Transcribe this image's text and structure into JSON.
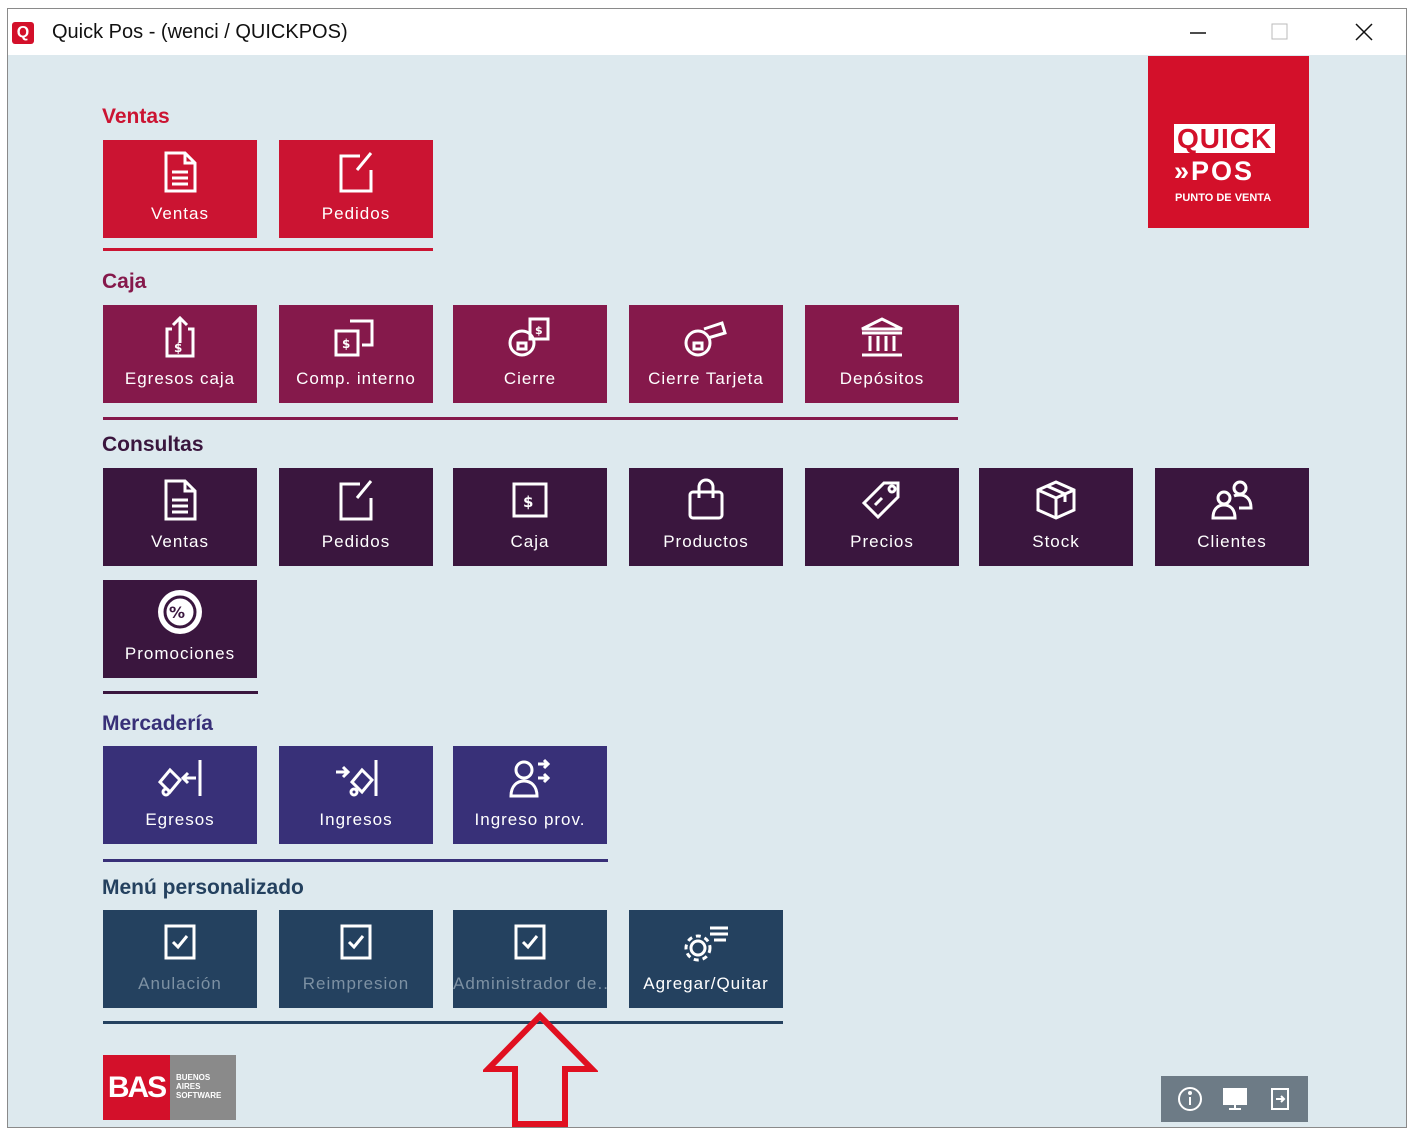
{
  "window": {
    "title": "Quick Pos - (wenci / QUICKPOS)",
    "app_icon": "Q",
    "controls": [
      "minimize-icon",
      "maximize-icon",
      "close-icon"
    ]
  },
  "logo": {
    "line1": "QUICK",
    "line2": "»POS",
    "line3": "PUNTO DE VENTA"
  },
  "sections": {
    "ventas": {
      "title": "Ventas",
      "color": "#cb1432",
      "tiles": [
        {
          "label": "Ventas",
          "icon": "document-icon"
        },
        {
          "label": "Pedidos",
          "icon": "edit-icon"
        }
      ]
    },
    "caja": {
      "title": "Caja",
      "color": "#85194b",
      "tiles": [
        {
          "label": "Egresos caja",
          "icon": "money-upload-icon"
        },
        {
          "label": "Comp. interno",
          "icon": "money-transfer-icon"
        },
        {
          "label": "Cierre",
          "icon": "cash-lock-icon"
        },
        {
          "label": "Cierre Tarjeta",
          "icon": "card-lock-icon"
        },
        {
          "label": "Depósitos",
          "icon": "bank-icon"
        }
      ]
    },
    "consultas": {
      "title": "Consultas",
      "color": "#3a163e",
      "tiles": [
        {
          "label": "Ventas",
          "icon": "document-icon"
        },
        {
          "label": "Pedidos",
          "icon": "edit-icon"
        },
        {
          "label": "Caja",
          "icon": "cash-icon"
        },
        {
          "label": "Productos",
          "icon": "shopping-bag-icon"
        },
        {
          "label": "Precios",
          "icon": "price-tag-icon"
        },
        {
          "label": "Stock",
          "icon": "box-icon"
        },
        {
          "label": "Clientes",
          "icon": "users-icon"
        },
        {
          "label": "Promociones",
          "icon": "percent-badge-icon"
        }
      ]
    },
    "mercaderia": {
      "title": "Mercadería",
      "color": "#383078",
      "tiles": [
        {
          "label": "Egresos",
          "icon": "dolly-out-icon"
        },
        {
          "label": "Ingresos",
          "icon": "dolly-in-icon"
        },
        {
          "label": "Ingreso prov.",
          "icon": "supplier-icon"
        }
      ]
    },
    "personalizado": {
      "title": "Menú personalizado",
      "color": "#24415f",
      "tiles": [
        {
          "label": "Anulación",
          "icon": "checkbox-icon",
          "enabled": false
        },
        {
          "label": "Reimpresion",
          "icon": "checkbox-icon",
          "enabled": false
        },
        {
          "label": "Administrador de..",
          "icon": "checkbox-icon",
          "enabled": false
        },
        {
          "label": "Agregar/Quitar",
          "icon": "gear-list-icon",
          "enabled": true
        }
      ]
    }
  },
  "bas_logo": {
    "text": "BAS",
    "subtext": [
      "BUENOS",
      "AIRES",
      "SOFTWARE"
    ]
  },
  "bottom_bar": [
    "info-icon",
    "monitor-icon",
    "exit-icon"
  ],
  "annotation": {
    "icon": "red-up-arrow-icon",
    "color": "#e01020"
  }
}
